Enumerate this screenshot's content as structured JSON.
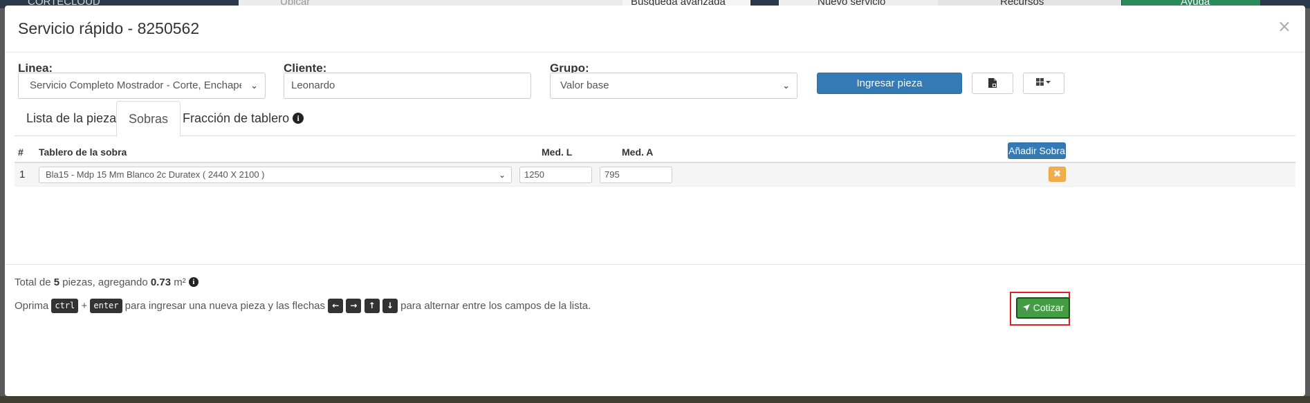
{
  "header": {
    "title": "Servicio rápido - 8250562",
    "close_glyph": "×"
  },
  "form": {
    "linea_label": "Linea:",
    "linea_value": "Servicio Completo Mostrador - Corte, Enchape y perforac",
    "cliente_label": "Cliente:",
    "cliente_value": "Leonardo",
    "grupo_label": "Grupo:",
    "grupo_value": "Valor base",
    "ingresar_label": "Ingresar pieza"
  },
  "tabs": [
    {
      "label": "Lista de la piezas",
      "active": false
    },
    {
      "label": "Sobras",
      "active": true
    },
    {
      "label": "Fracción de tablero",
      "active": false
    }
  ],
  "table": {
    "headers": [
      "#",
      "Tablero de la sobra",
      "Med. L",
      "Med. A"
    ],
    "add_label": "Añadir Sobra",
    "rows": [
      {
        "num": "1",
        "tablero": "Bla15 - Mdp 15 Mm Blanco 2c Duratex ( 2440 X 2100 )",
        "med_l": "1250",
        "med_a": "795"
      }
    ]
  },
  "footer": {
    "total_prefix": "Total de",
    "total_count": "5",
    "total_mid": "piezas, agregando",
    "total_area": "0.73",
    "total_unit": "m²",
    "help_prefix": "Oprima",
    "key_ctrl": "ctrl",
    "plus": "+",
    "key_enter": "enter",
    "help_mid": "para ingresar una nueva pieza y las flechas",
    "arrows": [
      "←",
      "→",
      "↑",
      "↓"
    ],
    "help_suffix": "para alternar entre los campos de la lista.",
    "cotizar_label": "Cotizar"
  },
  "background": {
    "buscar": "Ubicar",
    "avanzada": "Búsqueda avanzada",
    "nuevo": "Nuevo servicio",
    "recursos": "Recursos",
    "ayuda": "Ayuda",
    "logo": "CORTECLOUD"
  },
  "colors": {
    "primary": "#337ab7",
    "success": "#449d44",
    "warning": "#f0ad4e",
    "highlight": "#e02020"
  }
}
